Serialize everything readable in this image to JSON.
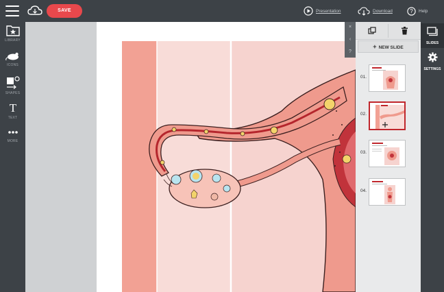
{
  "topbar": {
    "save_label": "SAVE",
    "presentation_label": "Presentation",
    "download_label": "Download",
    "help_label": "Help"
  },
  "left_toolbar": [
    {
      "label": "LIBRARY",
      "icon": "folder-star-icon"
    },
    {
      "label": "ICONS",
      "icon": "mouse-animal-icon"
    },
    {
      "label": "SHAPES",
      "icon": "shapes-icon"
    },
    {
      "label": "TEXT",
      "icon": "text-t-icon"
    },
    {
      "label": "MORE",
      "icon": "more-dots-icon"
    }
  ],
  "collapse": {
    "close": "×",
    "prev": "‹",
    "help": "?"
  },
  "slides_panel": {
    "new_slide_label": "NEW SLIDE",
    "thumbnails": [
      {
        "number": "01."
      },
      {
        "number": "02."
      },
      {
        "number": "03."
      },
      {
        "number": "04."
      }
    ],
    "active_index": 1
  },
  "right_tabs": [
    {
      "label": "SLIDES",
      "icon": "slides-icon"
    },
    {
      "label": "SETTINGS",
      "icon": "gear-icon"
    }
  ],
  "colors": {
    "accent": "#e8484c",
    "dark_bar": "#3d4247",
    "active_thumb_border": "#c0262c",
    "tissue_pink": "#ef9a8d"
  }
}
